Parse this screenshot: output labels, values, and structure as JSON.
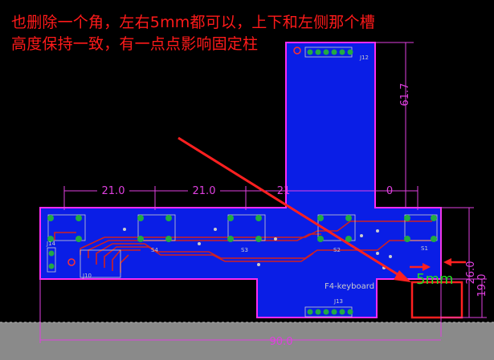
{
  "annotation": {
    "line1": "也删除一个角，左右5mm都可以，上下和左侧那个槽",
    "line2": "高度保持一致，有一点点影响固定柱",
    "gap_label": "5mm"
  },
  "dimensions": {
    "top_a": "21.0",
    "top_b": "21.0",
    "top_c": "21",
    "top_d": "0",
    "right_tall": "61.7",
    "right_a": "26.0",
    "right_b": "19.0",
    "bottom": "90.0"
  },
  "board": {
    "silk_title": "F4-keyboard",
    "silk_j12": "J12",
    "silk_j13": "J13",
    "silk_j14": "J14",
    "silk_j10": "J10",
    "silk_s1": "S1",
    "silk_s2": "S2",
    "silk_s3": "S3",
    "silk_s4": "S4"
  },
  "colors": {
    "background": "#000000",
    "board_fill": "#0a1ee6",
    "outline": "#ff2bf0",
    "dimension": "#e040e0",
    "trace": "#d02020",
    "annotation": "#ff1a1a",
    "gap_label": "#22dd22",
    "floor": "#8a8a8a"
  }
}
